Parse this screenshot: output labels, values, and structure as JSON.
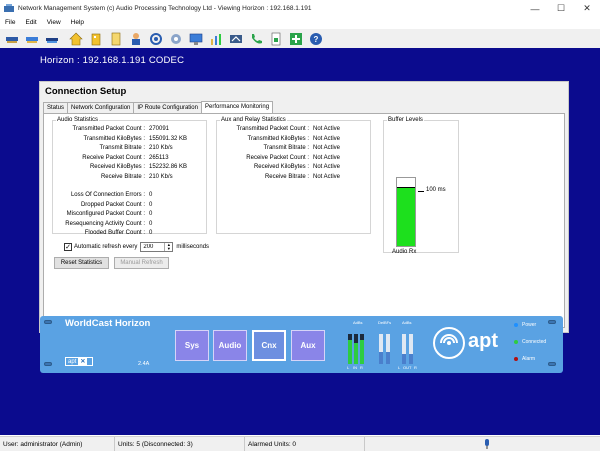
{
  "window": {
    "title": "Network Management System (c) Audio Processing Technology Ltd - Viewing Horizon : 192.168.1.191",
    "minimize": "—",
    "maximize": "☐",
    "close": "✕"
  },
  "menu": [
    "File",
    "Edit",
    "View",
    "Help"
  ],
  "toolbar": {
    "icons": [
      "network-icon",
      "network-alt-icon",
      "codec-icon",
      "home-icon",
      "building-icon",
      "document-icon",
      "user-icon",
      "settings-icon",
      "gear-icon",
      "monitor-icon",
      "chart-icon",
      "swap-icon",
      "phone-icon",
      "document-export-icon",
      "plus-icon",
      "help-icon"
    ]
  },
  "header": {
    "codec_title": "Horizon : 192.168.1.191 CODEC"
  },
  "panel": {
    "title": "Connection Setup",
    "tabs": [
      "Status",
      "Network Configuration",
      "IP Route Configuration",
      "Performance Monitoring"
    ],
    "active_tab": 3,
    "audio_stats": {
      "label": "Audio Statistics",
      "rows": [
        {
          "label": "Transmitted Packet Count :",
          "value": "270091"
        },
        {
          "label": "Transmitted KiloBytes :",
          "value": "155091.32 KB"
        },
        {
          "label": "Transmit Bitrate :",
          "value": "210 Kb/s"
        },
        {
          "label": "Receive Packet Count :",
          "value": "265113"
        },
        {
          "label": "Received KiloBytes :",
          "value": "152232.86 KB"
        },
        {
          "label": "Receive Bitrate :",
          "value": "210 Kb/s"
        }
      ],
      "errors": [
        {
          "label": "Loss Of Connection Errors :",
          "value": "0"
        },
        {
          "label": "Dropped Packet Count :",
          "value": "0"
        },
        {
          "label": "Misconfigured Packet Count :",
          "value": "0"
        },
        {
          "label": "Resequencing Activity Count :",
          "value": "0"
        },
        {
          "label": "Flooded Buffer Count :",
          "value": "0"
        }
      ]
    },
    "aux_stats": {
      "label": "Aux and Relay Statistics",
      "rows": [
        {
          "label": "Transmitted Packet Count :",
          "value": "Not Active"
        },
        {
          "label": "Transmitted KiloBytes :",
          "value": "Not Active"
        },
        {
          "label": "Transmit Bitrate :",
          "value": "Not Active"
        },
        {
          "label": "Receive Packet Count :",
          "value": "Not Active"
        },
        {
          "label": "Received KiloBytes :",
          "value": "Not Active"
        },
        {
          "label": "Receive Bitrate :",
          "value": "Not Active"
        }
      ]
    },
    "buffer": {
      "label": "Buffer Levels",
      "bar_label": "Audio Rx",
      "marker_label": "100 ms",
      "fill_fraction": 0.87,
      "fill_color": "#1de01d"
    },
    "refresh": {
      "checked": true,
      "label": "Automatic refresh every",
      "value": "200",
      "unit": "milliseconds"
    },
    "buttons": {
      "reset": "Reset Statistics",
      "manual": "Manual Refresh"
    }
  },
  "device": {
    "title": "WorldCast Horizon",
    "logo_text": "apt",
    "version": "2.4A",
    "buttons": [
      "Sys",
      "Audio",
      "Cnx",
      "Aux"
    ],
    "active_button": 2,
    "meter_groups": [
      "AdBs",
      "DelBFs",
      "AdBs"
    ],
    "meter_sub": [
      "L",
      "IN",
      "R",
      "L",
      "OUT",
      "R"
    ],
    "brand": "apt",
    "leds": [
      {
        "label": "Power",
        "color": "#1e90ff"
      },
      {
        "label": "Connected",
        "color": "#2ecc40"
      },
      {
        "label": "Alarm",
        "color": "#b01010"
      }
    ],
    "colors": {
      "panel": "#5aa2e3",
      "button": "#8a85e8"
    }
  },
  "status": {
    "user": "User: administrator (Admin)",
    "units": "Units: 5 (Disconnected: 3)",
    "alarmed": "Alarmed Units: 0"
  }
}
